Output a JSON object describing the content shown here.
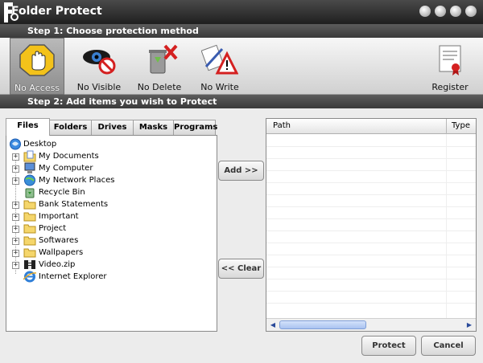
{
  "window": {
    "title": "Folder Protect"
  },
  "steps": {
    "step1": "Step 1: Choose protection method",
    "step2": "Step 2: Add items you wish to Protect"
  },
  "toolbar": {
    "no_access": "No Access",
    "no_visible": "No Visible",
    "no_delete": "No Delete",
    "no_write": "No Write",
    "register": "Register",
    "selected": "no_access"
  },
  "tabs": [
    "Files",
    "Folders",
    "Drives",
    "Masks",
    "Programs"
  ],
  "tree": {
    "root": "Desktop",
    "items": [
      {
        "label": "My Documents",
        "icon": "documents-folder-icon",
        "expandable": true
      },
      {
        "label": "My Computer",
        "icon": "computer-icon",
        "expandable": true
      },
      {
        "label": "My Network Places",
        "icon": "network-places-icon",
        "expandable": true
      },
      {
        "label": "Recycle Bin",
        "icon": "recycle-bin-icon",
        "expandable": false
      },
      {
        "label": "Bank Statements",
        "icon": "folder-icon",
        "expandable": true
      },
      {
        "label": "Important",
        "icon": "folder-icon",
        "expandable": true
      },
      {
        "label": "Project",
        "icon": "folder-icon",
        "expandable": true
      },
      {
        "label": "Softwares",
        "icon": "folder-icon",
        "expandable": true
      },
      {
        "label": "Wallpapers",
        "icon": "folder-icon",
        "expandable": true
      },
      {
        "label": "Video.zip",
        "icon": "zip-icon",
        "expandable": true
      },
      {
        "label": "Internet Explorer",
        "icon": "internet-explorer-icon",
        "expandable": false
      }
    ]
  },
  "actions": {
    "add": "Add  >>",
    "clear": "<< Clear"
  },
  "list": {
    "col_path": "Path",
    "col_type": "Type"
  },
  "buttons": {
    "protect": "Protect",
    "cancel": "Cancel"
  },
  "colors": {
    "titlebar": "#2b2b2b",
    "stepbar": "#4a4a4a",
    "scroll_thumb": "#a9c2f0"
  }
}
